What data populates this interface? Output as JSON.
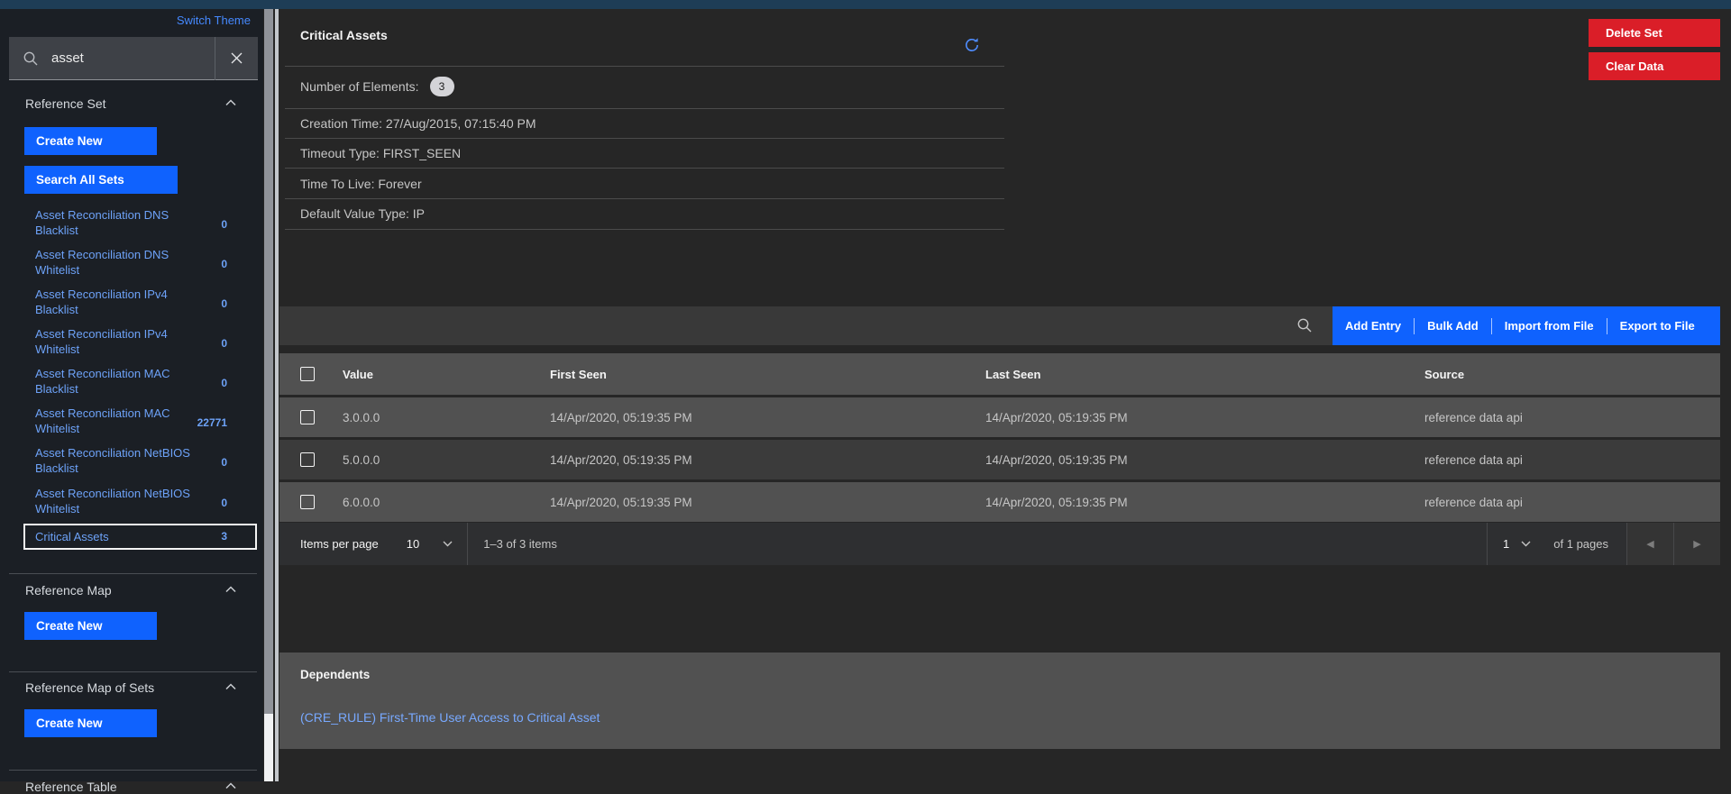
{
  "theme": {
    "accent_blue": "#0f62fe",
    "link_blue": "#4589ff",
    "danger_red": "#da1e28",
    "top_bar": "#1e3d56"
  },
  "top": {
    "switch_theme_label": "Switch Theme"
  },
  "sidebar": {
    "search": {
      "value": "asset"
    },
    "sections": {
      "reference_set": {
        "label": "Reference Set",
        "create_label": "Create New",
        "search_all_label": "Search All Sets"
      },
      "reference_map": {
        "label": "Reference Map",
        "create_label": "Create New"
      },
      "reference_map_of_sets": {
        "label": "Reference Map of Sets",
        "create_label": "Create New"
      },
      "reference_table": {
        "label": "Reference Table"
      }
    },
    "sets": [
      {
        "name": "Asset Reconciliation DNS Blacklist",
        "count": "0"
      },
      {
        "name": "Asset Reconciliation DNS Whitelist",
        "count": "0"
      },
      {
        "name": "Asset Reconciliation IPv4 Blacklist",
        "count": "0"
      },
      {
        "name": "Asset Reconciliation IPv4 Whitelist",
        "count": "0"
      },
      {
        "name": "Asset Reconciliation MAC Blacklist",
        "count": "0"
      },
      {
        "name": "Asset Reconciliation MAC Whitelist",
        "count": "22771"
      },
      {
        "name": "Asset Reconciliation NetBIOS Blacklist",
        "count": "0"
      },
      {
        "name": "Asset Reconciliation NetBIOS Whitelist",
        "count": "0"
      }
    ],
    "selected_set": {
      "name": "Critical Assets",
      "count": "3"
    }
  },
  "header": {
    "title": "Critical Assets",
    "delete_label": "Delete Set",
    "clear_label": "Clear Data"
  },
  "details": {
    "number_of_elements_label": "Number of Elements:",
    "number_of_elements": "3",
    "rows": [
      "Creation Time: 27/Aug/2015, 07:15:40 PM",
      "Timeout Type: FIRST_SEEN",
      "Time To Live: Forever",
      "Default Value Type: IP"
    ]
  },
  "table": {
    "actions": [
      "Add Entry",
      "Bulk Add",
      "Import from File",
      "Export to File"
    ],
    "columns": [
      "Value",
      "First Seen",
      "Last Seen",
      "Source"
    ],
    "rows": [
      {
        "value": "3.0.0.0",
        "first_seen": "14/Apr/2020, 05:19:35 PM",
        "last_seen": "14/Apr/2020, 05:19:35 PM",
        "source": "reference data api"
      },
      {
        "value": "5.0.0.0",
        "first_seen": "14/Apr/2020, 05:19:35 PM",
        "last_seen": "14/Apr/2020, 05:19:35 PM",
        "source": "reference data api"
      },
      {
        "value": "6.0.0.0",
        "first_seen": "14/Apr/2020, 05:19:35 PM",
        "last_seen": "14/Apr/2020, 05:19:35 PM",
        "source": "reference data api"
      }
    ],
    "pagination": {
      "items_per_page_label": "Items per page",
      "page_size": "10",
      "range_text": "1–3 of 3 items",
      "page": "1",
      "pages_text": "of 1 pages",
      "prev_icon": "◀",
      "next_icon": "▶"
    }
  },
  "dependents": {
    "title": "Dependents",
    "link": "(CRE_RULE) First-Time User Access to Critical Asset"
  }
}
